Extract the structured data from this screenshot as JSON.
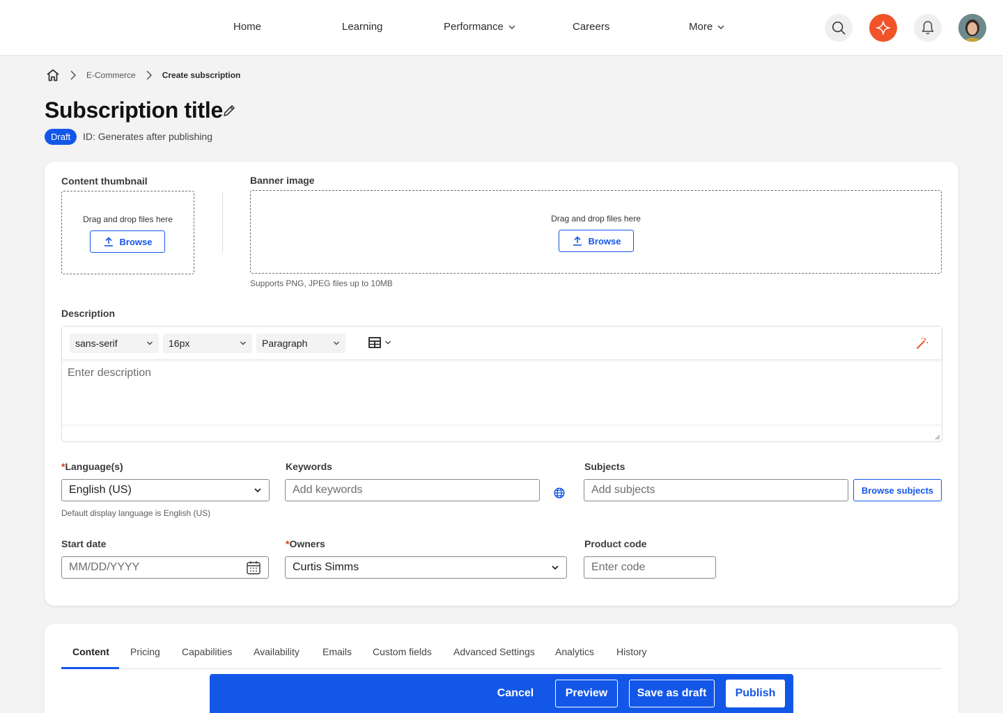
{
  "nav": {
    "items": [
      {
        "label": "Home",
        "has_dropdown": false
      },
      {
        "label": "Learning",
        "has_dropdown": false
      },
      {
        "label": "Performance",
        "has_dropdown": true
      },
      {
        "label": "Careers",
        "has_dropdown": false
      },
      {
        "label": "More",
        "has_dropdown": true
      }
    ],
    "icons": [
      "search-icon",
      "sparkle-icon",
      "bell-icon",
      "user-avatar"
    ],
    "accent_color": "#f0532a"
  },
  "breadcrumb": {
    "items": [
      "E-Commerce",
      "Create subscription"
    ]
  },
  "page": {
    "title": "Subscription title",
    "status_badge": "Draft",
    "id_text": "ID: Generates after publishing"
  },
  "media": {
    "thumbnail_label": "Content thumbnail",
    "banner_label": "Banner image",
    "drop_text": "Drag and drop files here",
    "browse_label": "Browse",
    "support_hint": "Supports PNG, JPEG files up to 10MB"
  },
  "description": {
    "label": "Description",
    "font_family": "sans-serif",
    "font_size": "16px",
    "block_type": "Paragraph",
    "placeholder": "Enter description"
  },
  "form": {
    "languages_label": "Language(s)",
    "languages_value": "English (US)",
    "languages_hint": "Default display language is English (US)",
    "keywords_label": "Keywords",
    "keywords_placeholder": "Add keywords",
    "subjects_label": "Subjects",
    "subjects_placeholder": "Add subjects",
    "browse_subjects_label": "Browse subjects",
    "start_date_label": "Start date",
    "start_date_placeholder": "MM/DD/YYYY",
    "owners_label": "Owners",
    "owners_value": "Curtis Simms",
    "product_code_label": "Product code",
    "product_code_placeholder": "Enter code",
    "required_mark": "*"
  },
  "tabs": {
    "items": [
      "Content",
      "Pricing",
      "Capabilities",
      "Availability",
      "Emails",
      "Custom fields",
      "Advanced Settings",
      "Analytics",
      "History"
    ],
    "active": "Content"
  },
  "actions": {
    "cancel": "Cancel",
    "preview": "Preview",
    "save_draft": "Save as draft",
    "publish": "Publish"
  },
  "colors": {
    "primary": "#1357e8",
    "required": "#d63c1f"
  }
}
